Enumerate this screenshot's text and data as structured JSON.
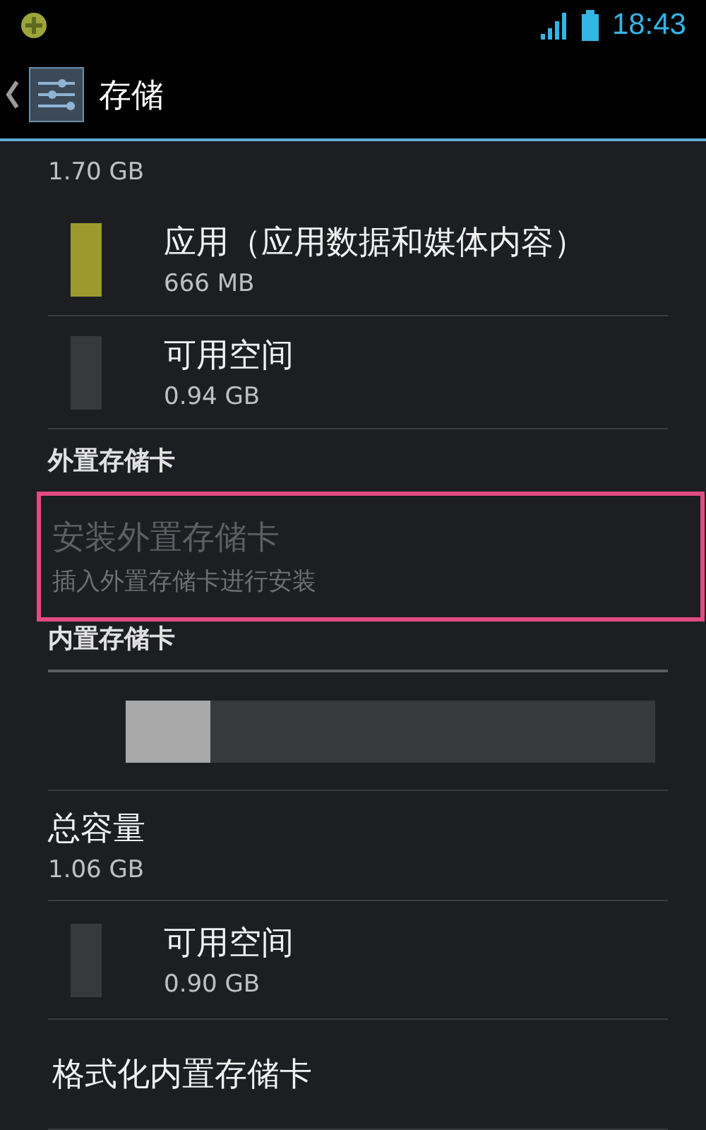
{
  "status_bar": {
    "time": "18:43"
  },
  "action_bar": {
    "title": "存储"
  },
  "entries": [
    {
      "kind": "summary",
      "value": "1.70 GB"
    },
    {
      "kind": "usage",
      "title": "应用（应用数据和媒体内容）",
      "value": "666 MB",
      "color": "#9a9b2c"
    },
    {
      "kind": "usage",
      "title": "可用空间",
      "value": "0.94 GB",
      "color": "#38393b"
    },
    {
      "kind": "header",
      "title": "外置存储卡",
      "underline": false
    },
    {
      "kind": "action",
      "title": "安装外置存储卡",
      "summary": "插入外置存储卡进行安装",
      "disabled": true,
      "marked": true
    },
    {
      "kind": "header",
      "title": "内置存储卡",
      "underline": true
    },
    {
      "kind": "bar",
      "level": 0.16
    },
    {
      "kind": "total",
      "title": "总容量",
      "value": "1.06 GB"
    },
    {
      "kind": "usage",
      "title": "可用空间",
      "value": "0.90 GB",
      "color": "#38393b"
    },
    {
      "kind": "action",
      "title": "格式化内置存储卡",
      "disabled": false,
      "marked": false
    }
  ]
}
